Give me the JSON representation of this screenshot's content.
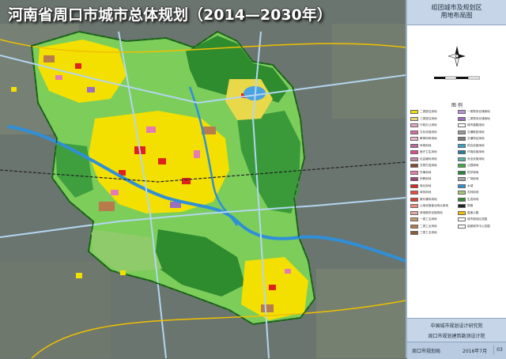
{
  "header": {
    "title": "河南省周口市城市总体规划（2014—2030年）"
  },
  "panel": {
    "subtitle_line1": "组团城市及规划区",
    "subtitle_line2": "用地布局图"
  },
  "map": {
    "compass_icon": "north-arrow-icon",
    "scale_icon": "scale-bar-icon",
    "colors": {
      "background_satellite": "#6b756f",
      "ecological_green_dark": "#2e8b2e",
      "ecological_green_light": "#7ccd5a",
      "farmland": "#a8c67a",
      "residential": "#f3e000",
      "commercial": "#e0221f",
      "public_service": "#e57bb5",
      "industrial": "#b77b4c",
      "river": "#2f8fd8",
      "road": "#b3d6f0",
      "boundary": "#1e6f1e"
    }
  },
  "legend": {
    "title": "图 例",
    "items": [
      {
        "label": "二类居住用地",
        "color": "#f3e000"
      },
      {
        "label": "三类居住用地",
        "color": "#e7d37a"
      },
      {
        "label": "行政办公用地",
        "color": "#e6a6c4"
      },
      {
        "label": "文化设施用地",
        "color": "#d96ca6"
      },
      {
        "label": "教育科研用地",
        "color": "#f1b3d2"
      },
      {
        "label": "体育用地",
        "color": "#b96aa0"
      },
      {
        "label": "医疗卫生用地",
        "color": "#e64a8c"
      },
      {
        "label": "社会福利用地",
        "color": "#c18aa9"
      },
      {
        "label": "文物古迹用地",
        "color": "#8a4a2a"
      },
      {
        "label": "外事用地",
        "color": "#f07cb0"
      },
      {
        "label": "宗教用地",
        "color": "#a4407b"
      },
      {
        "label": "商业用地",
        "color": "#e0221f"
      },
      {
        "label": "商务用地",
        "color": "#f04a3a"
      },
      {
        "label": "娱乐康体用地",
        "color": "#d8403a"
      },
      {
        "label": "公用设施营业网点用地",
        "color": "#f28a7a"
      },
      {
        "label": "其他服务设施用地",
        "color": "#e9a6a0"
      },
      {
        "label": "一类工业用地",
        "color": "#c79c6e"
      },
      {
        "label": "二类工业用地",
        "color": "#b77b4c"
      },
      {
        "label": "三类工业用地",
        "color": "#8c5a34"
      },
      {
        "label": "一类物流仓储用地",
        "color": "#b893d6"
      },
      {
        "label": "二类物流仓储用地",
        "color": "#9a6fc0"
      },
      {
        "label": "城市道路用地",
        "color": "#ffffff"
      },
      {
        "label": "交通枢纽用地",
        "color": "#9a9a9a"
      },
      {
        "label": "交通场站用地",
        "color": "#7a7a7a"
      },
      {
        "label": "供应设施用地",
        "color": "#3aa0c8"
      },
      {
        "label": "环境设施用地",
        "color": "#2a7a9a"
      },
      {
        "label": "安全设施用地",
        "color": "#5ab8a0"
      },
      {
        "label": "公园绿地",
        "color": "#3cb03c"
      },
      {
        "label": "防护绿地",
        "color": "#1e8a3a"
      },
      {
        "label": "广场用地",
        "color": "#a8a8a8"
      },
      {
        "label": "水域",
        "color": "#2f8fd8"
      },
      {
        "label": "农林用地",
        "color": "#a8c67a"
      },
      {
        "label": "生态用地",
        "color": "#2e8b2e"
      },
      {
        "label": "铁路",
        "color": "#222222"
      },
      {
        "label": "高速公路",
        "color": "#f0c000"
      },
      {
        "label": "城市规划区范围",
        "color": "#ffffff"
      },
      {
        "label": "组团城市中心范围",
        "color": "#ffffff"
      }
    ]
  },
  "credits": {
    "org1": "中国城市规划设计研究院",
    "org2": "周口市规划建筑勘测设计院",
    "bureau": "周口市规划局",
    "date": "2016年7月",
    "page": "03"
  }
}
